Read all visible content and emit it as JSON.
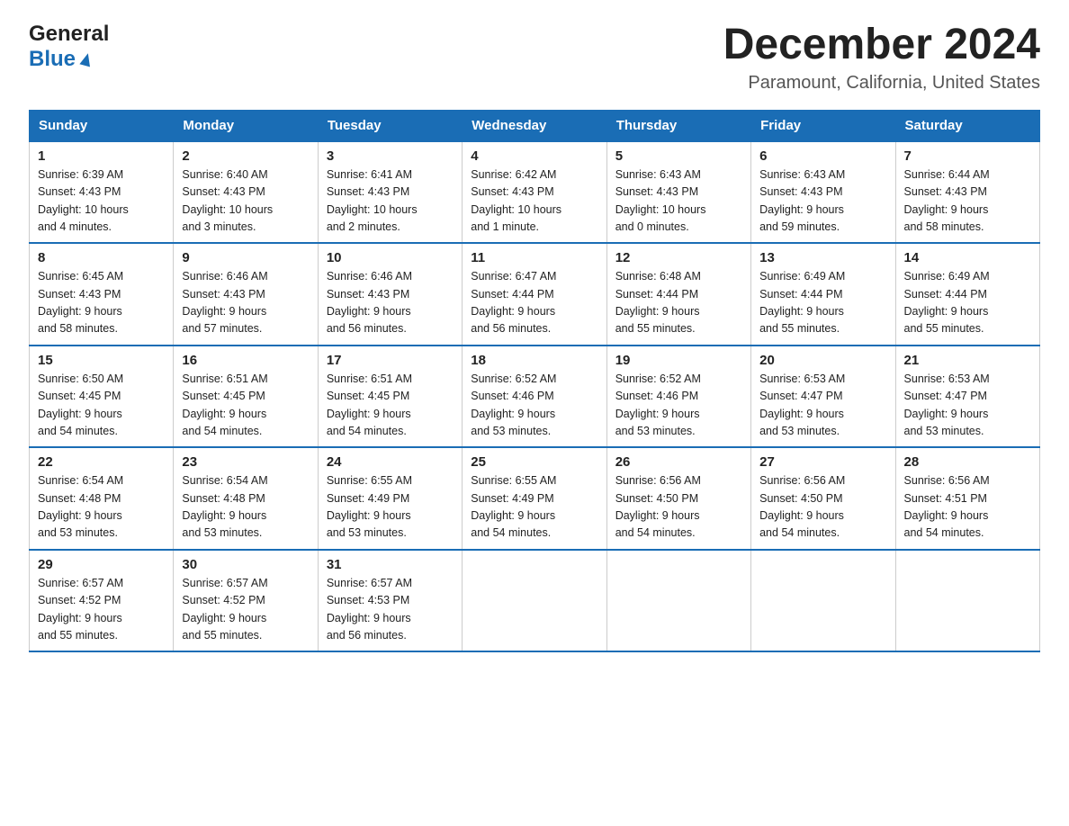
{
  "header": {
    "logo": {
      "general": "General",
      "blue": "Blue",
      "triangle_label": "logo-triangle"
    },
    "title": "December 2024",
    "location": "Paramount, California, United States"
  },
  "weekdays": [
    "Sunday",
    "Monday",
    "Tuesday",
    "Wednesday",
    "Thursday",
    "Friday",
    "Saturday"
  ],
  "weeks": [
    [
      {
        "day": "1",
        "sunrise": "Sunrise: 6:39 AM",
        "sunset": "Sunset: 4:43 PM",
        "daylight": "Daylight: 10 hours",
        "daylight2": "and 4 minutes."
      },
      {
        "day": "2",
        "sunrise": "Sunrise: 6:40 AM",
        "sunset": "Sunset: 4:43 PM",
        "daylight": "Daylight: 10 hours",
        "daylight2": "and 3 minutes."
      },
      {
        "day": "3",
        "sunrise": "Sunrise: 6:41 AM",
        "sunset": "Sunset: 4:43 PM",
        "daylight": "Daylight: 10 hours",
        "daylight2": "and 2 minutes."
      },
      {
        "day": "4",
        "sunrise": "Sunrise: 6:42 AM",
        "sunset": "Sunset: 4:43 PM",
        "daylight": "Daylight: 10 hours",
        "daylight2": "and 1 minute."
      },
      {
        "day": "5",
        "sunrise": "Sunrise: 6:43 AM",
        "sunset": "Sunset: 4:43 PM",
        "daylight": "Daylight: 10 hours",
        "daylight2": "and 0 minutes."
      },
      {
        "day": "6",
        "sunrise": "Sunrise: 6:43 AM",
        "sunset": "Sunset: 4:43 PM",
        "daylight": "Daylight: 9 hours",
        "daylight2": "and 59 minutes."
      },
      {
        "day": "7",
        "sunrise": "Sunrise: 6:44 AM",
        "sunset": "Sunset: 4:43 PM",
        "daylight": "Daylight: 9 hours",
        "daylight2": "and 58 minutes."
      }
    ],
    [
      {
        "day": "8",
        "sunrise": "Sunrise: 6:45 AM",
        "sunset": "Sunset: 4:43 PM",
        "daylight": "Daylight: 9 hours",
        "daylight2": "and 58 minutes."
      },
      {
        "day": "9",
        "sunrise": "Sunrise: 6:46 AM",
        "sunset": "Sunset: 4:43 PM",
        "daylight": "Daylight: 9 hours",
        "daylight2": "and 57 minutes."
      },
      {
        "day": "10",
        "sunrise": "Sunrise: 6:46 AM",
        "sunset": "Sunset: 4:43 PM",
        "daylight": "Daylight: 9 hours",
        "daylight2": "and 56 minutes."
      },
      {
        "day": "11",
        "sunrise": "Sunrise: 6:47 AM",
        "sunset": "Sunset: 4:44 PM",
        "daylight": "Daylight: 9 hours",
        "daylight2": "and 56 minutes."
      },
      {
        "day": "12",
        "sunrise": "Sunrise: 6:48 AM",
        "sunset": "Sunset: 4:44 PM",
        "daylight": "Daylight: 9 hours",
        "daylight2": "and 55 minutes."
      },
      {
        "day": "13",
        "sunrise": "Sunrise: 6:49 AM",
        "sunset": "Sunset: 4:44 PM",
        "daylight": "Daylight: 9 hours",
        "daylight2": "and 55 minutes."
      },
      {
        "day": "14",
        "sunrise": "Sunrise: 6:49 AM",
        "sunset": "Sunset: 4:44 PM",
        "daylight": "Daylight: 9 hours",
        "daylight2": "and 55 minutes."
      }
    ],
    [
      {
        "day": "15",
        "sunrise": "Sunrise: 6:50 AM",
        "sunset": "Sunset: 4:45 PM",
        "daylight": "Daylight: 9 hours",
        "daylight2": "and 54 minutes."
      },
      {
        "day": "16",
        "sunrise": "Sunrise: 6:51 AM",
        "sunset": "Sunset: 4:45 PM",
        "daylight": "Daylight: 9 hours",
        "daylight2": "and 54 minutes."
      },
      {
        "day": "17",
        "sunrise": "Sunrise: 6:51 AM",
        "sunset": "Sunset: 4:45 PM",
        "daylight": "Daylight: 9 hours",
        "daylight2": "and 54 minutes."
      },
      {
        "day": "18",
        "sunrise": "Sunrise: 6:52 AM",
        "sunset": "Sunset: 4:46 PM",
        "daylight": "Daylight: 9 hours",
        "daylight2": "and 53 minutes."
      },
      {
        "day": "19",
        "sunrise": "Sunrise: 6:52 AM",
        "sunset": "Sunset: 4:46 PM",
        "daylight": "Daylight: 9 hours",
        "daylight2": "and 53 minutes."
      },
      {
        "day": "20",
        "sunrise": "Sunrise: 6:53 AM",
        "sunset": "Sunset: 4:47 PM",
        "daylight": "Daylight: 9 hours",
        "daylight2": "and 53 minutes."
      },
      {
        "day": "21",
        "sunrise": "Sunrise: 6:53 AM",
        "sunset": "Sunset: 4:47 PM",
        "daylight": "Daylight: 9 hours",
        "daylight2": "and 53 minutes."
      }
    ],
    [
      {
        "day": "22",
        "sunrise": "Sunrise: 6:54 AM",
        "sunset": "Sunset: 4:48 PM",
        "daylight": "Daylight: 9 hours",
        "daylight2": "and 53 minutes."
      },
      {
        "day": "23",
        "sunrise": "Sunrise: 6:54 AM",
        "sunset": "Sunset: 4:48 PM",
        "daylight": "Daylight: 9 hours",
        "daylight2": "and 53 minutes."
      },
      {
        "day": "24",
        "sunrise": "Sunrise: 6:55 AM",
        "sunset": "Sunset: 4:49 PM",
        "daylight": "Daylight: 9 hours",
        "daylight2": "and 53 minutes."
      },
      {
        "day": "25",
        "sunrise": "Sunrise: 6:55 AM",
        "sunset": "Sunset: 4:49 PM",
        "daylight": "Daylight: 9 hours",
        "daylight2": "and 54 minutes."
      },
      {
        "day": "26",
        "sunrise": "Sunrise: 6:56 AM",
        "sunset": "Sunset: 4:50 PM",
        "daylight": "Daylight: 9 hours",
        "daylight2": "and 54 minutes."
      },
      {
        "day": "27",
        "sunrise": "Sunrise: 6:56 AM",
        "sunset": "Sunset: 4:50 PM",
        "daylight": "Daylight: 9 hours",
        "daylight2": "and 54 minutes."
      },
      {
        "day": "28",
        "sunrise": "Sunrise: 6:56 AM",
        "sunset": "Sunset: 4:51 PM",
        "daylight": "Daylight: 9 hours",
        "daylight2": "and 54 minutes."
      }
    ],
    [
      {
        "day": "29",
        "sunrise": "Sunrise: 6:57 AM",
        "sunset": "Sunset: 4:52 PM",
        "daylight": "Daylight: 9 hours",
        "daylight2": "and 55 minutes."
      },
      {
        "day": "30",
        "sunrise": "Sunrise: 6:57 AM",
        "sunset": "Sunset: 4:52 PM",
        "daylight": "Daylight: 9 hours",
        "daylight2": "and 55 minutes."
      },
      {
        "day": "31",
        "sunrise": "Sunrise: 6:57 AM",
        "sunset": "Sunset: 4:53 PM",
        "daylight": "Daylight: 9 hours",
        "daylight2": "and 56 minutes."
      },
      null,
      null,
      null,
      null
    ]
  ]
}
